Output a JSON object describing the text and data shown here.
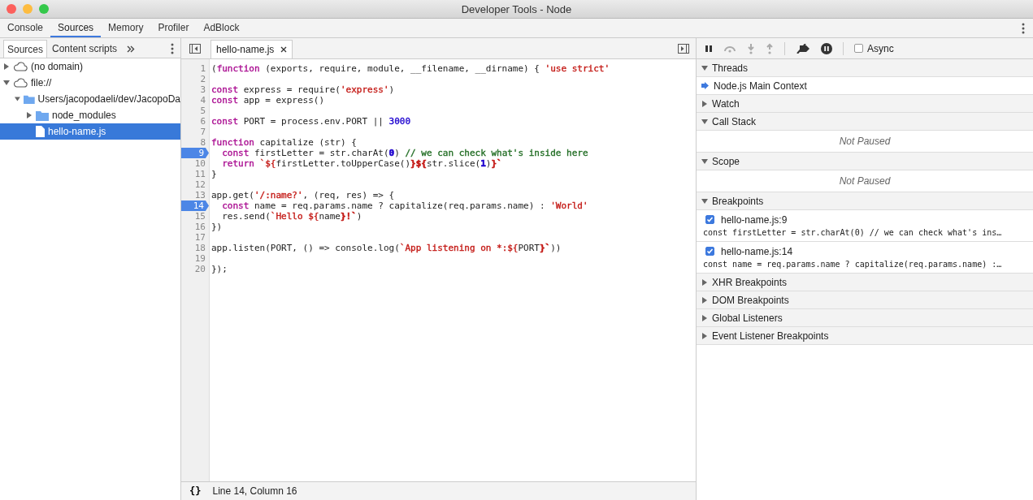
{
  "window": {
    "title": "Developer Tools - Node"
  },
  "tabs": [
    {
      "label": "Console",
      "selected": false
    },
    {
      "label": "Sources",
      "selected": true
    },
    {
      "label": "Memory",
      "selected": false
    },
    {
      "label": "Profiler",
      "selected": false
    },
    {
      "label": "AdBlock",
      "selected": false
    }
  ],
  "navigator": {
    "tabs": [
      {
        "label": "Sources",
        "selected": true
      },
      {
        "label": "Content scripts",
        "selected": false
      }
    ],
    "tree": [
      {
        "label": "(no domain)",
        "kind": "cloud",
        "expanded": false,
        "selected": false
      },
      {
        "label": "file://",
        "kind": "cloud",
        "expanded": true,
        "selected": false,
        "children": [
          {
            "label": "Users/jacopodaeli/dev/JacopoDa",
            "kind": "folder",
            "expanded": true,
            "selected": false,
            "children": [
              {
                "label": "node_modules",
                "kind": "folder",
                "expanded": false,
                "selected": false
              },
              {
                "label": "hello-name.js",
                "kind": "file",
                "selected": true
              }
            ]
          }
        ]
      }
    ]
  },
  "editor": {
    "file_tab": "hello-name.js",
    "lines": [
      {
        "n": "1",
        "breakpoint": false,
        "tokens": [
          {
            "t": "("
          },
          {
            "t": "function",
            "color": "#aa0d91"
          },
          {
            "t": " (exports, require, module, __filename, __dirname) { "
          },
          {
            "t": "'use strict'",
            "color": "#c41a16"
          }
        ]
      },
      {
        "n": "2",
        "breakpoint": false
      },
      {
        "n": "3",
        "breakpoint": false,
        "tokens": [
          {
            "t": "const",
            "color": "#aa0d91"
          },
          {
            "t": " express = require("
          },
          {
            "t": "'express'",
            "color": "#c41a16"
          },
          {
            "t": ")"
          }
        ]
      },
      {
        "n": "4",
        "breakpoint": false,
        "tokens": [
          {
            "t": "const",
            "color": "#aa0d91"
          },
          {
            "t": " app = express()"
          }
        ]
      },
      {
        "n": "5",
        "breakpoint": false
      },
      {
        "n": "6",
        "breakpoint": false,
        "tokens": [
          {
            "t": "const",
            "color": "#aa0d91"
          },
          {
            "t": " PORT = process.env.PORT || "
          },
          {
            "t": "3000",
            "color": "#1c00cf"
          }
        ]
      },
      {
        "n": "7",
        "breakpoint": false
      },
      {
        "n": "8",
        "breakpoint": false,
        "tokens": [
          {
            "t": "function",
            "color": "#aa0d91"
          },
          {
            "t": " capitalize (str) {"
          }
        ]
      },
      {
        "n": "9",
        "breakpoint": true,
        "tokens": [
          {
            "t": "  const",
            "color": "#aa0d91"
          },
          {
            "t": " firstLetter = str.charAt("
          },
          {
            "t": "0",
            "color": "#1c00cf"
          },
          {
            "t": ") "
          },
          {
            "t": "// we can check what's inside here",
            "color": "#236e25"
          }
        ]
      },
      {
        "n": "10",
        "breakpoint": false,
        "tokens": [
          {
            "t": "  return",
            "color": "#aa0d91"
          },
          {
            "t": " `${",
            "color": "#c41a16"
          },
          {
            "t": "firstLetter.toUpperCase()"
          },
          {
            "t": "}${",
            "color": "#c41a16"
          },
          {
            "t": "str.slice("
          },
          {
            "t": "1",
            "color": "#1c00cf"
          },
          {
            "t": ")"
          },
          {
            "t": "}`",
            "color": "#c41a16"
          }
        ]
      },
      {
        "n": "11",
        "breakpoint": false,
        "tokens": [
          {
            "t": "}"
          }
        ]
      },
      {
        "n": "12",
        "breakpoint": false
      },
      {
        "n": "13",
        "breakpoint": false,
        "tokens": [
          {
            "t": "app.get("
          },
          {
            "t": "'/:name?'",
            "color": "#c41a16"
          },
          {
            "t": ", (req, res) => {"
          }
        ]
      },
      {
        "n": "14",
        "breakpoint": true,
        "tokens": [
          {
            "t": "  const",
            "color": "#aa0d91"
          },
          {
            "t": " name = req.params.name ? capitalize(req.params.name) : "
          },
          {
            "t": "'World'",
            "color": "#c41a16"
          }
        ]
      },
      {
        "n": "15",
        "breakpoint": false,
        "tokens": [
          {
            "t": "  res.send("
          },
          {
            "t": "`Hello ${",
            "color": "#c41a16"
          },
          {
            "t": "name"
          },
          {
            "t": "}!`",
            "color": "#c41a16"
          },
          {
            "t": ")"
          }
        ]
      },
      {
        "n": "16",
        "breakpoint": false,
        "tokens": [
          {
            "t": "})"
          }
        ]
      },
      {
        "n": "17",
        "breakpoint": false
      },
      {
        "n": "18",
        "breakpoint": false,
        "tokens": [
          {
            "t": "app.listen(PORT, () => console.log("
          },
          {
            "t": "`App listening on *:${",
            "color": "#c41a16"
          },
          {
            "t": "PORT"
          },
          {
            "t": "}`",
            "color": "#c41a16"
          },
          {
            "t": "))"
          }
        ]
      },
      {
        "n": "19",
        "breakpoint": false
      },
      {
        "n": "20",
        "breakpoint": false,
        "tokens": [
          {
            "t": "});"
          }
        ]
      }
    ],
    "status": {
      "format_button": "{}",
      "position": "Line 14, Column 16"
    }
  },
  "debugger": {
    "async_checked": false,
    "async_label": "Async",
    "sections": [
      {
        "title": "Threads",
        "expanded": true,
        "kind": "threads",
        "items": [
          {
            "label": "Node.js Main Context",
            "selected": true
          }
        ]
      },
      {
        "title": "Watch",
        "expanded": false
      },
      {
        "title": "Call Stack",
        "expanded": true,
        "kind": "message",
        "message": "Not Paused"
      },
      {
        "title": "Scope",
        "expanded": true,
        "kind": "message",
        "message": "Not Paused"
      },
      {
        "title": "Breakpoints",
        "expanded": true,
        "kind": "breakpoints",
        "items": [
          {
            "location": "hello-name.js:9",
            "code": "const firstLetter = str.charAt(0) // we can check what's ins…",
            "checked": true
          },
          {
            "location": "hello-name.js:14",
            "code": "const name = req.params.name ? capitalize(req.params.name) :…",
            "checked": true
          }
        ]
      },
      {
        "title": "XHR Breakpoints",
        "expanded": false
      },
      {
        "title": "DOM Breakpoints",
        "expanded": false
      },
      {
        "title": "Global Listeners",
        "expanded": false
      },
      {
        "title": "Event Listener Breakpoints",
        "expanded": false
      }
    ]
  }
}
